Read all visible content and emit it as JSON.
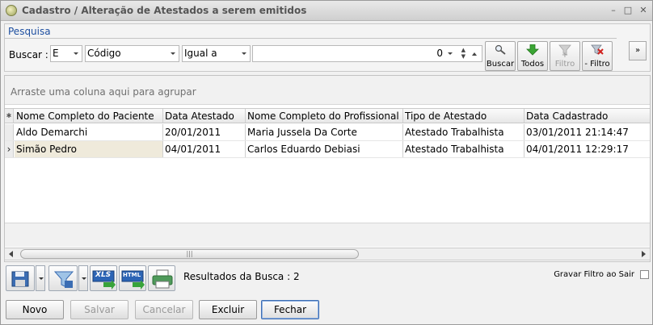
{
  "window": {
    "title": "Cadastro / Alteração de Atestados a serem emitidos",
    "controls": [
      "–",
      "□",
      "✕"
    ]
  },
  "search": {
    "panel_label": "Pesquisa",
    "buscar_label": "Buscar :",
    "logic_value": "E",
    "field_value": "Código",
    "operator_value": "Igual a",
    "number_value": "0",
    "buttons": {
      "buscar": "Buscar",
      "todos": "Todos",
      "add_filtro": "+ Filtro",
      "remove_filtro": "- Filtro"
    },
    "collapse_glyph": "»"
  },
  "grid": {
    "group_hint": "Arraste uma coluna aqui para agrupar",
    "indicator_glyph": "✱",
    "columns": [
      "Nome Completo do Paciente",
      "Data Atestado",
      "Nome Completo do Profissional",
      "Tipo de Atestado",
      "Data Cadastrado"
    ],
    "rows": [
      [
        "Aldo Demarchi",
        "20/01/2011",
        "Maria Jussela Da Corte",
        "Atestado Trabalhista",
        "03/01/2011 21:14:47"
      ],
      [
        "Simão Pedro",
        "04/01/2011",
        "Carlos Eduardo Debiasi",
        "Atestado Trabalhista",
        "04/01/2011 12:29:17"
      ]
    ],
    "selected_row_indicator": "›",
    "scroll_grip": "|||"
  },
  "footer": {
    "results": "Resultados da Busca : 2",
    "gravar_filtro": "Gravar Filtro ao Sair",
    "icons": {
      "xls": "XLS",
      "html": "HTML"
    }
  },
  "actions": {
    "novo": "Novo",
    "salvar": "Salvar",
    "cancelar": "Cancelar",
    "excluir": "Excluir",
    "fechar": "Fechar"
  },
  "colors": {
    "title_blue": "#1e4fa0",
    "selected_cell": "#efeadb",
    "focus_border": "#3d6eb4"
  }
}
